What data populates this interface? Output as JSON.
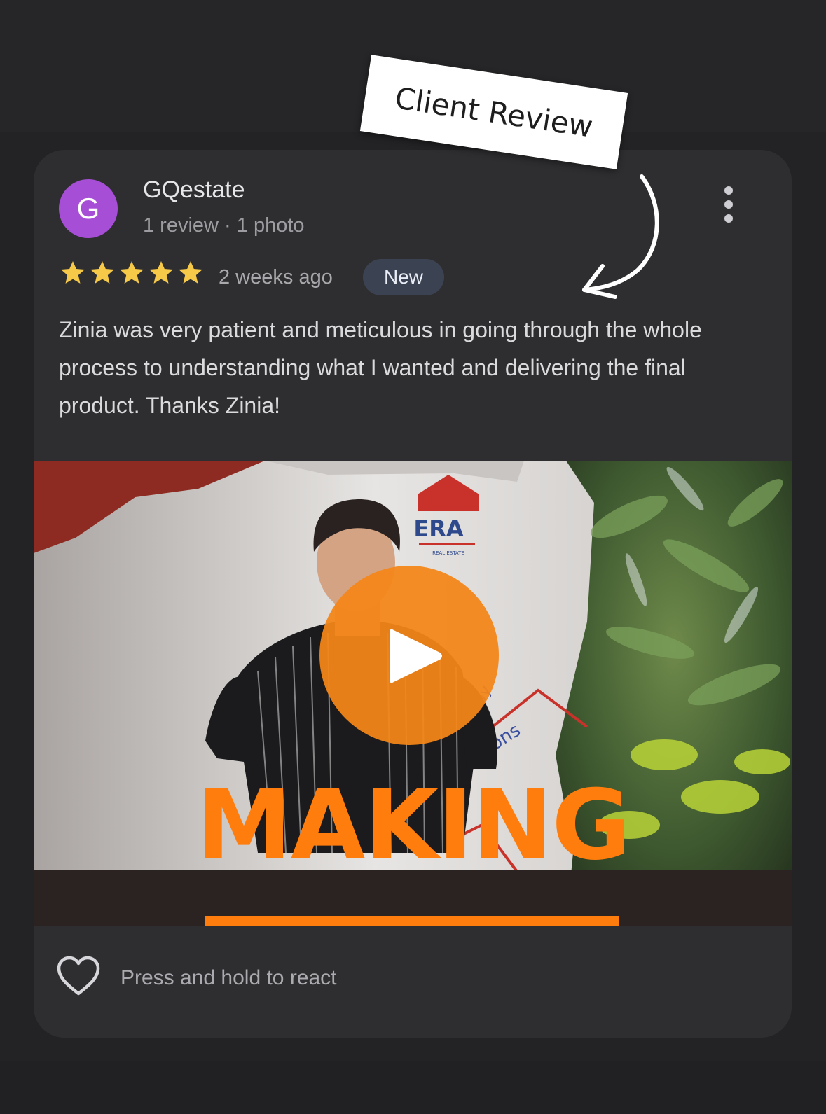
{
  "annotation": {
    "label": "Client Review"
  },
  "review": {
    "avatar_letter": "G",
    "reviewer_name": "GQestate",
    "reviewer_meta": "1 review · 1 photo",
    "rating": 5,
    "rating_max": 5,
    "time_ago": "2 weeks ago",
    "badge": "New",
    "text": "Zinia was very patient and meticulous in going through the whole process to understanding what I wanted and delivering the final product. Thanks Zinia!"
  },
  "media": {
    "type": "video",
    "logo_text": "ERA",
    "logo_subtext": "REAL ESTATE",
    "wall_text": "ERAtions",
    "wall_text_small": "by",
    "overlay_title": "MAKING"
  },
  "reaction": {
    "prompt": "Press and hold to react"
  },
  "icons": {
    "more": "more-vertical-icon",
    "star": "star-icon",
    "play": "play-icon",
    "heart": "heart-outline-icon",
    "arrow": "curved-arrow-icon"
  },
  "colors": {
    "avatar": "#a64fd6",
    "star": "#f7c948",
    "badge_bg": "#3b4252",
    "play_button": "#f38618",
    "overlay_title": "#ff7d0d",
    "card_bg": "#2e2e30"
  }
}
